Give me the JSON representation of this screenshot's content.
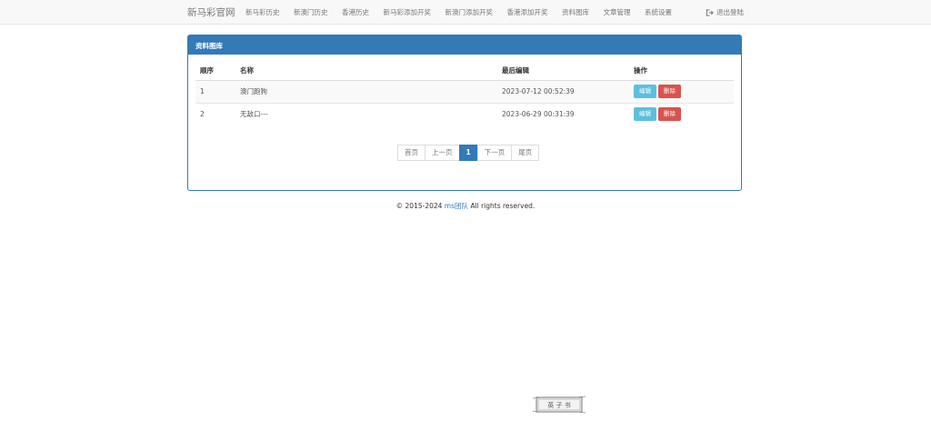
{
  "navbar": {
    "brand": "新马彩官网",
    "items": [
      "新马彩历史",
      "新澳门历史",
      "香港历史",
      "新马彩添加开奖",
      "新澳门添加开奖",
      "香港添加开奖",
      "资料图库",
      "文章管理",
      "系统设置"
    ],
    "logout": "退出登陆"
  },
  "panel": {
    "title": "资料图库",
    "columns": [
      "顺序",
      "名称",
      "最后编辑",
      "操作"
    ],
    "rows": [
      {
        "seq": "1",
        "name": "澳门跑狗",
        "date": "2023-07-12 00:52:39",
        "edit": "编辑",
        "delete": "删除"
      },
      {
        "seq": "2",
        "name": "无敌口---",
        "date": "2023-06-29 00:31:39",
        "edit": "编辑",
        "delete": "删除"
      }
    ]
  },
  "pagination": {
    "first": "首页",
    "prev": "上一页",
    "current": "1",
    "next": "下一页",
    "last": "尾页"
  },
  "footer": {
    "prefix": "© 2015-2024 ",
    "link": "ms团队",
    "suffix": " All rights reserved."
  },
  "stamp": {
    "text": "英 子 书"
  }
}
